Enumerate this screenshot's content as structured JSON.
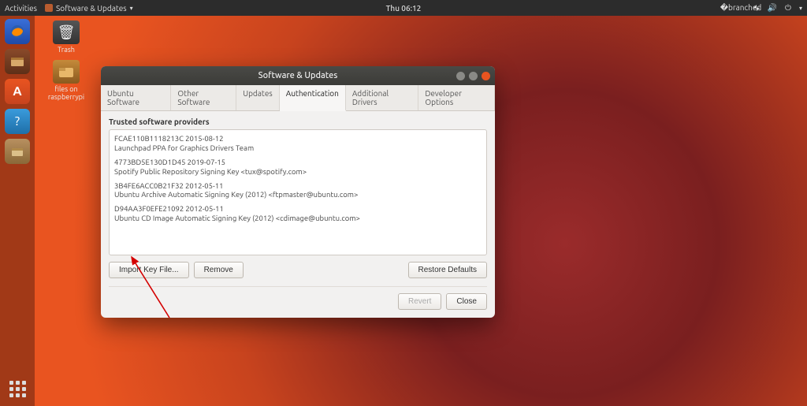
{
  "topbar": {
    "activities": "Activities",
    "app_name": "Software & Updates",
    "clock": "Thu 06:12"
  },
  "desktop": {
    "trash": "Trash",
    "remote": "files on raspberrypi"
  },
  "window": {
    "title": "Software & Updates",
    "tabs": [
      "Ubuntu Software",
      "Other Software",
      "Updates",
      "Authentication",
      "Additional Drivers",
      "Developer Options"
    ],
    "active_tab_index": 3,
    "section_label": "Trusted software providers",
    "keys": [
      {
        "id": "FCAE110B1118213C 2015-08-12",
        "desc": "Launchpad PPA for Graphics Drivers Team"
      },
      {
        "id": "4773BD5E130D1D45 2019-07-15",
        "desc": "Spotify Public Repository Signing Key <tux@spotify.com>"
      },
      {
        "id": "3B4FE6ACC0B21F32 2012-05-11",
        "desc": "Ubuntu Archive Automatic Signing Key (2012) <ftpmaster@ubuntu.com>"
      },
      {
        "id": "D94AA3F0EFE21092 2012-05-11",
        "desc": "Ubuntu CD Image Automatic Signing Key (2012) <cdimage@ubuntu.com>"
      }
    ],
    "buttons": {
      "import": "Import Key File...",
      "remove": "Remove",
      "restore": "Restore Defaults",
      "revert": "Revert",
      "close": "Close"
    }
  }
}
